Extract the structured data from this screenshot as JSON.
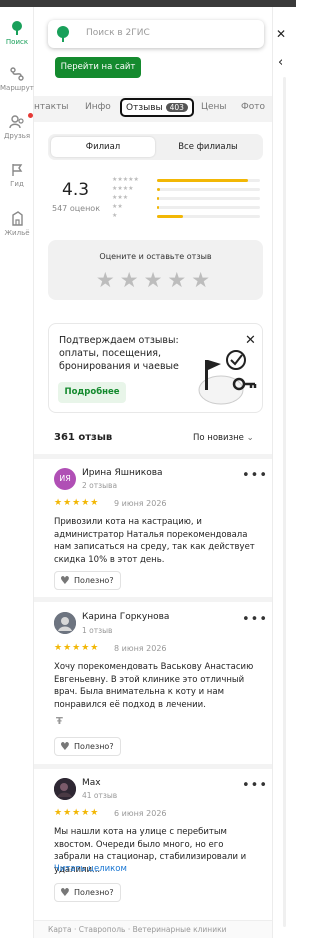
{
  "rail": {
    "items": [
      {
        "label": "Поиск",
        "icon": "search-pin-icon"
      },
      {
        "label": "Маршруты",
        "icon": "route-icon"
      },
      {
        "label": "Друзья",
        "icon": "friends-icon"
      },
      {
        "label": "Гид",
        "icon": "flag-icon"
      },
      {
        "label": "Жильё",
        "icon": "building-icon"
      }
    ],
    "accent": "#19a05a"
  },
  "search": {
    "placeholder": "Поиск в 2ГИС"
  },
  "site_button": "Перейти на сайт",
  "tabs": {
    "items": [
      "нтакты",
      "Инфо",
      "Отзывы",
      "Цены",
      "Фото"
    ],
    "active_count": "403"
  },
  "segment": {
    "branch": "Филиал",
    "all": "Все филиалы"
  },
  "rating": {
    "score": "4.3",
    "count": "547 оценок",
    "distribution": [
      0.88,
      0.03,
      0.02,
      0.02,
      0.25
    ]
  },
  "rate_prompt": "Оцените и оставьте отзыв",
  "promo": {
    "text": "Подтверждаем отзывы: оплаты, посещения, бронирования и чаевые",
    "button": "Подробнее"
  },
  "reviews_header": {
    "count": "361 отзыв",
    "sort": "По новизне"
  },
  "reviews": [
    {
      "avatar_text": "ИЯ",
      "name": "Ирина Яшникова",
      "count": "2 отзыва",
      "date": "9 июня 2026",
      "text": "Привозили кота на кастрацию, и администратор Наталья порекомендовала нам записаться на среду, так как действует скидка 10% в этот день.",
      "useful": "Полезно?"
    },
    {
      "avatar_text": "",
      "name": "Карина Горкунова",
      "count": "1 отзыв",
      "date": "8 июня 2026",
      "text": "Хочу порекомендовать Васькову Анастасию Евгеньевну. В этой клинике это отличный врач. Была внимательна к коту и нам понравился её подход в лечении.",
      "useful": "Полезно?"
    },
    {
      "avatar_text": "",
      "name": "Max",
      "count": "41 отзыв",
      "date": "6 июня 2026",
      "text": "Мы нашли кота на улице с перебитым хвостом. Очереди было много, но его забрали на стационар, стабилизировали и удалили...",
      "read_more": "Читать целиком",
      "useful": "Полезно?"
    }
  ],
  "footer": "Карта · Ставрополь · Ветеринарные клиники"
}
